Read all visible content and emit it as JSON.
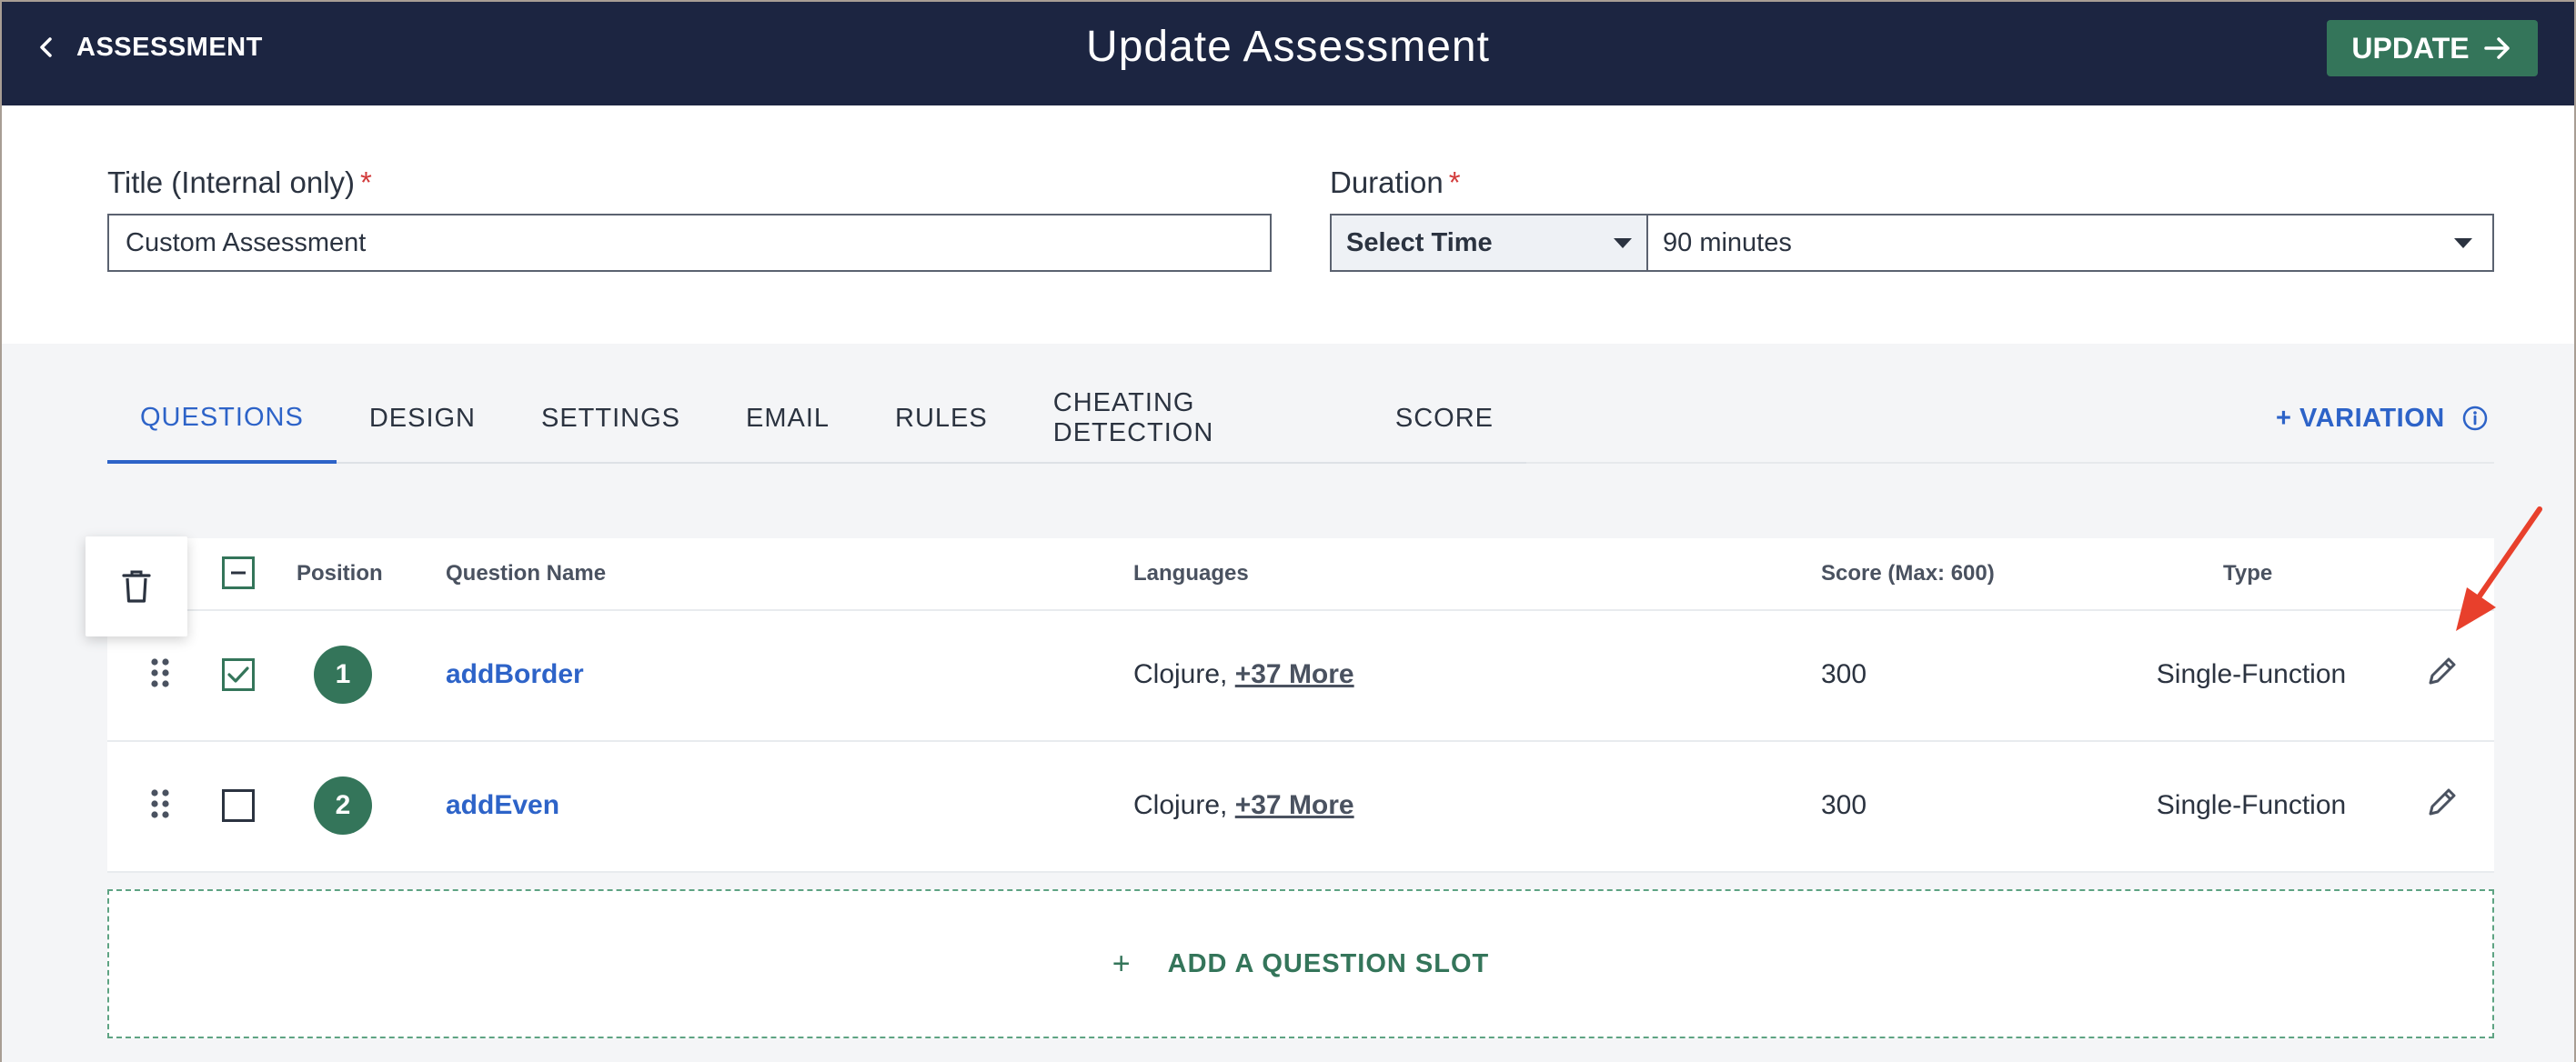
{
  "header": {
    "back_label": "ASSESSMENT",
    "title": "Update Assessment",
    "update_label": "UPDATE"
  },
  "form": {
    "title_label": "Title (Internal only)",
    "title_required": "*",
    "title_value": "Custom Assessment",
    "duration_label": "Duration",
    "duration_required": "*",
    "time_select": "Select Time",
    "duration_value": "90 minutes"
  },
  "tabs": [
    {
      "label": "QUESTIONS",
      "active": true
    },
    {
      "label": "DESIGN"
    },
    {
      "label": "SETTINGS"
    },
    {
      "label": "EMAIL"
    },
    {
      "label": "RULES"
    },
    {
      "label": "CHEATING DETECTION"
    },
    {
      "label": "SCORE"
    }
  ],
  "variation_label": "+ VARIATION",
  "table": {
    "headers": {
      "position": "Position",
      "question_name": "Question Name",
      "languages": "Languages",
      "score": "Score (Max: 600)",
      "type": "Type"
    },
    "rows": [
      {
        "position": "1",
        "name": "addBorder",
        "language": "Clojure,",
        "more": "+37 More",
        "score": "300",
        "type": "Single-Function",
        "checked": true
      },
      {
        "position": "2",
        "name": "addEven",
        "language": "Clojure,",
        "more": "+37 More",
        "score": "300",
        "type": "Single-Function",
        "checked": false
      }
    ]
  },
  "add_slot": {
    "plus": "+",
    "label": "ADD A QUESTION SLOT"
  },
  "icons": {
    "back": "chevron-left-icon",
    "update": "arrow-right-icon",
    "info": "info-icon",
    "trash": "trash-icon",
    "drag": "drag-handle-icon",
    "edit": "pencil-icon",
    "annotation": "red-arrow-icon"
  },
  "colors": {
    "header_bg": "#1c2541",
    "accent_green": "#34755a",
    "link_blue": "#2d63c8",
    "required_red": "#d23b3b",
    "annotation_red": "#e8402c"
  }
}
